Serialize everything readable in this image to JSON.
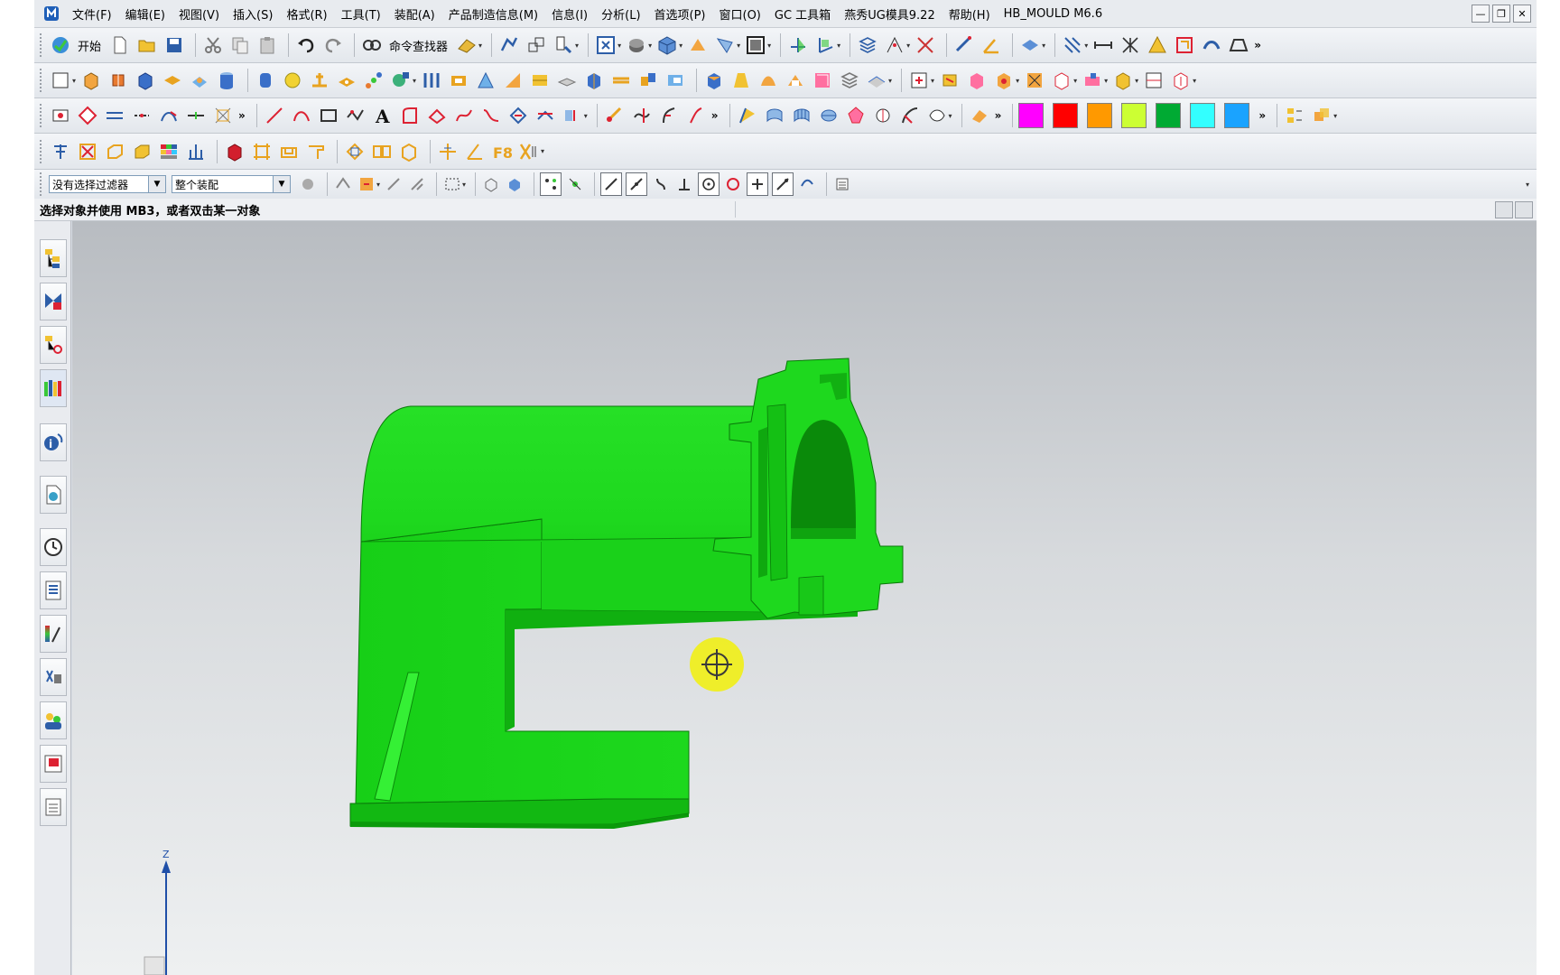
{
  "app": {
    "menus": [
      "文件(F)",
      "编辑(E)",
      "视图(V)",
      "插入(S)",
      "格式(R)",
      "工具(T)",
      "装配(A)",
      "产品制造信息(M)",
      "信息(I)",
      "分析(L)",
      "首选项(P)",
      "窗口(O)",
      "GC 工具箱",
      "燕秀UG模具9.22",
      "帮助(H)",
      "HB_MOULD M6.6"
    ],
    "window_buttons": [
      "—",
      "❐",
      "✕"
    ]
  },
  "toolbar": {
    "start_label": "开始",
    "command_finder_label": "命令查找器",
    "more_glyph": "»"
  },
  "colors": {
    "swatches": [
      "#ff00ff",
      "#ff0000",
      "#ff9900",
      "#ccff33",
      "#00aa33",
      "#33ffff",
      "#1aa3ff"
    ],
    "model_green": "#1fd81f",
    "model_dark": "#0ea30e"
  },
  "filters": {
    "type_filter": "没有选择过滤器",
    "scope_filter": "整个装配"
  },
  "status": {
    "prompt": "选择对象并使用 MB3，或者双击某一对象"
  },
  "triad": {
    "z_label": "Z"
  },
  "resource_bar": [
    "assembly-navigator-icon",
    "constraint-navigator-icon",
    "part-navigator-icon",
    "reuse-library-icon",
    "hd3d-tools-icon",
    "web-browser-icon",
    "history-icon",
    "process-studio-icon",
    "visualization-icon",
    "roles-icon",
    "system-materials-icon",
    "palette-icon",
    "manufacturing-wizard-icon"
  ]
}
